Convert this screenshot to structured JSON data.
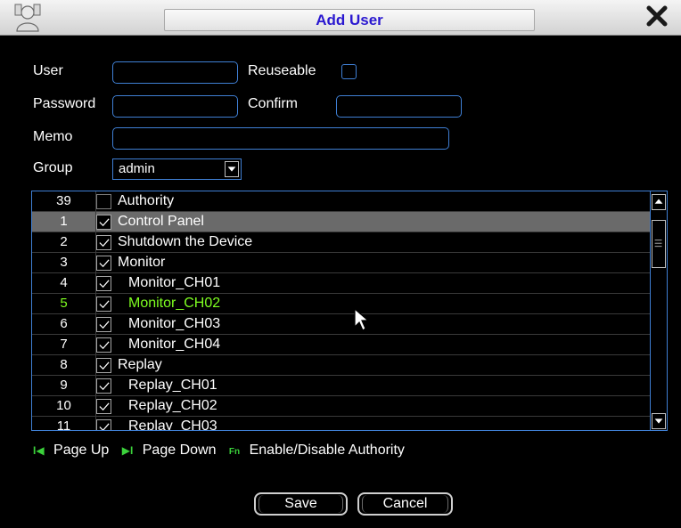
{
  "window": {
    "title": "Add User",
    "icon": "user-icon",
    "close_icon": "close-icon"
  },
  "form": {
    "user_label": "User",
    "user_value": "",
    "reuseable_label": "Reuseable",
    "reuseable_checked": false,
    "password_label": "Password",
    "password_value": "",
    "confirm_label": "Confirm",
    "confirm_value": "",
    "memo_label": "Memo",
    "memo_value": "",
    "group_label": "Group",
    "group_value": "admin"
  },
  "authority_table": {
    "header": {
      "count": "39",
      "label": "Authority",
      "checked": false
    },
    "rows": [
      {
        "num": "1",
        "label": "Control Panel",
        "checked": true,
        "indent": false,
        "selected": true
      },
      {
        "num": "2",
        "label": "Shutdown the Device",
        "checked": true,
        "indent": false
      },
      {
        "num": "3",
        "label": "Monitor",
        "checked": true,
        "indent": false
      },
      {
        "num": "4",
        "label": "Monitor_CH01",
        "checked": true,
        "indent": true
      },
      {
        "num": "5",
        "label": "Monitor_CH02",
        "checked": true,
        "indent": true,
        "highlight": true
      },
      {
        "num": "6",
        "label": "Monitor_CH03",
        "checked": true,
        "indent": true
      },
      {
        "num": "7",
        "label": "Monitor_CH04",
        "checked": true,
        "indent": true
      },
      {
        "num": "8",
        "label": "Replay",
        "checked": true,
        "indent": false
      },
      {
        "num": "9",
        "label": "Replay_CH01",
        "checked": true,
        "indent": true
      },
      {
        "num": "10",
        "label": "Replay_CH02",
        "checked": true,
        "indent": true
      },
      {
        "num": "11",
        "label": "Replay_CH03",
        "checked": true,
        "indent": true
      }
    ]
  },
  "hints": {
    "page_up_icon": "I◀",
    "page_up": "Page Up",
    "page_down_icon": "▶I",
    "page_down": "Page Down",
    "fn_icon": "Fn",
    "fn_text": "Enable/Disable Authority"
  },
  "buttons": {
    "save": "Save",
    "cancel": "Cancel"
  },
  "colors": {
    "accent": "#3f7fd4",
    "title_text": "#2a18d0",
    "highlight": "#7fff21",
    "selected_row": "#6a6a6a"
  }
}
